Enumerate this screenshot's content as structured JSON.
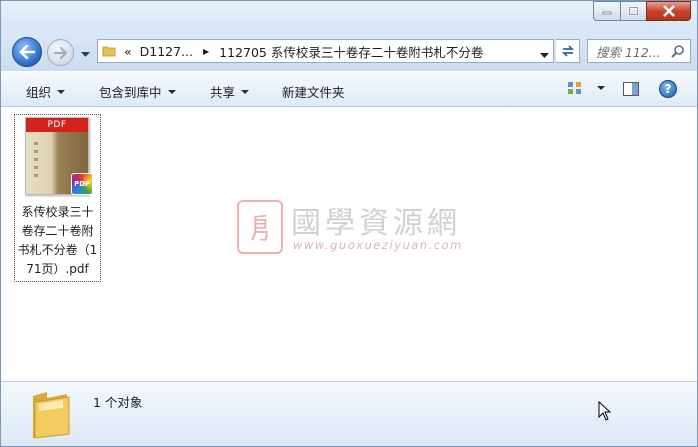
{
  "caption": {
    "minimize": "minimize",
    "maximize": "maximize",
    "close": "close"
  },
  "address": {
    "overflow": "«",
    "segments": [
      "D1127...",
      "112705 系传校录三十卷存二十卷附书札不分卷"
    ]
  },
  "search": {
    "placeholder": "搜索 112..."
  },
  "toolbar": {
    "organize": "组织",
    "include_library": "包含到库中",
    "share": "共享",
    "new_folder": "新建文件夹",
    "help": "?"
  },
  "files": [
    {
      "name": "系传校录三十卷存二十卷附书札不分卷（171页）.pdf",
      "thumb_header": "PDF",
      "badge": "PDF"
    }
  ],
  "watermark": {
    "title": "國學資源網",
    "url": "www.guoxueziyuan.com",
    "seal": "㐆"
  },
  "details": {
    "count": "1 个对象"
  },
  "colors": {
    "accent": "#2a6fc7",
    "close": "#c7442f",
    "pdf_red": "#d2241c"
  }
}
